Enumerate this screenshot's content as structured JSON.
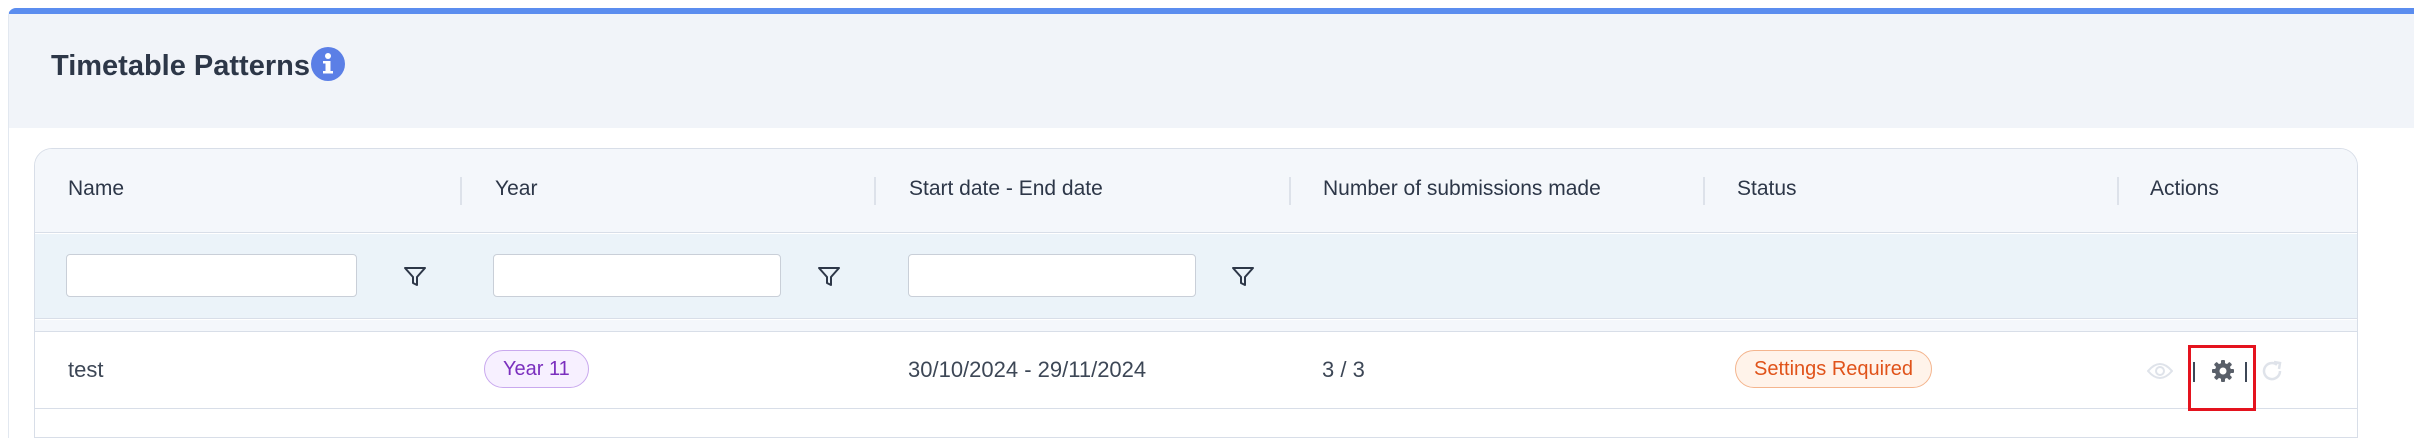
{
  "panel": {
    "title": "Timetable Patterns",
    "info_icon": "info-circle-icon",
    "accent_color": "#5b8def"
  },
  "table": {
    "columns": [
      {
        "label": "Name",
        "filterable": true
      },
      {
        "label": "Year",
        "filterable": true
      },
      {
        "label": "Start date - End date",
        "filterable": true
      },
      {
        "label": "Number of submissions made",
        "filterable": false
      },
      {
        "label": "Status",
        "filterable": false
      },
      {
        "label": "Actions",
        "filterable": false
      }
    ],
    "filters": {
      "name_value": "",
      "year_value": "",
      "date_value": ""
    },
    "rows": [
      {
        "name": "test",
        "year": "Year 11",
        "dates": "30/10/2024 - 29/11/2024",
        "submissions": "3 / 3",
        "status": "Settings Required",
        "actions": [
          "eye-icon",
          "gear-icon",
          "refresh-icon"
        ]
      }
    ]
  },
  "colors": {
    "year_badge": "#7b2fbe",
    "status_badge": "#e0531a",
    "highlight": "#e4131e"
  }
}
